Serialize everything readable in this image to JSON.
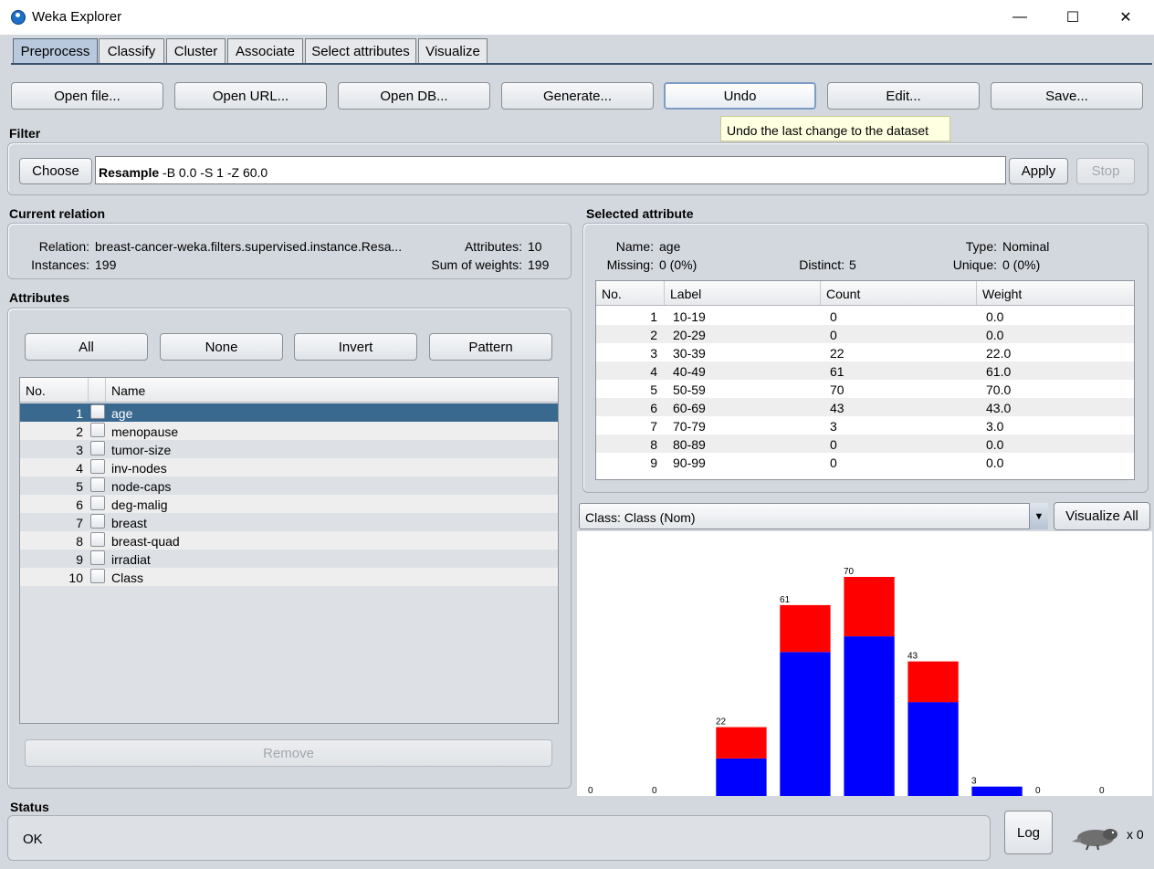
{
  "window": {
    "title": "Weka Explorer",
    "minimize": "—",
    "maximize": "☐",
    "close": "✕"
  },
  "tabs": [
    "Preprocess",
    "Classify",
    "Cluster",
    "Associate",
    "Select attributes",
    "Visualize"
  ],
  "toolbar": [
    "Open file...",
    "Open URL...",
    "Open DB...",
    "Generate...",
    "Undo",
    "Edit...",
    "Save..."
  ],
  "tooltip": "Undo the last change to the dataset",
  "filter": {
    "label": "Filter",
    "choose": "Choose",
    "name": "Resample",
    "options": " -B 0.0 -S 1 -Z 60.0",
    "apply": "Apply",
    "stop": "Stop"
  },
  "relation": {
    "label": "Current relation",
    "relation_label": "Relation:",
    "relation_value": "breast-cancer-weka.filters.supervised.instance.Resa...",
    "instances_label": "Instances:",
    "instances_value": "199",
    "attributes_label": "Attributes:",
    "attributes_value": "10",
    "sow_label": "Sum of weights:",
    "sow_value": "199"
  },
  "attributes": {
    "label": "Attributes",
    "buttons": [
      "All",
      "None",
      "Invert",
      "Pattern"
    ],
    "col_no": "No.",
    "col_name": "Name",
    "rows": [
      {
        "no": "1",
        "name": "age"
      },
      {
        "no": "2",
        "name": "menopause"
      },
      {
        "no": "3",
        "name": "tumor-size"
      },
      {
        "no": "4",
        "name": "inv-nodes"
      },
      {
        "no": "5",
        "name": "node-caps"
      },
      {
        "no": "6",
        "name": "deg-malig"
      },
      {
        "no": "7",
        "name": "breast"
      },
      {
        "no": "8",
        "name": "breast-quad"
      },
      {
        "no": "9",
        "name": "irradiat"
      },
      {
        "no": "10",
        "name": "Class"
      }
    ],
    "remove": "Remove"
  },
  "selected": {
    "label": "Selected attribute",
    "name_label": "Name:",
    "name_value": "age",
    "type_label": "Type:",
    "type_value": "Nominal",
    "missing_label": "Missing:",
    "missing_value": "0 (0%)",
    "distinct_label": "Distinct:",
    "distinct_value": "5",
    "unique_label": "Unique:",
    "unique_value": "0 (0%)",
    "cols": [
      "No.",
      "Label",
      "Count",
      "Weight"
    ],
    "rows": [
      {
        "no": "1",
        "label": "10-19",
        "count": "0",
        "weight": "0.0"
      },
      {
        "no": "2",
        "label": "20-29",
        "count": "0",
        "weight": "0.0"
      },
      {
        "no": "3",
        "label": "30-39",
        "count": "22",
        "weight": "22.0"
      },
      {
        "no": "4",
        "label": "40-49",
        "count": "61",
        "weight": "61.0"
      },
      {
        "no": "5",
        "label": "50-59",
        "count": "70",
        "weight": "70.0"
      },
      {
        "no": "6",
        "label": "60-69",
        "count": "43",
        "weight": "43.0"
      },
      {
        "no": "7",
        "label": "70-79",
        "count": "3",
        "weight": "3.0"
      },
      {
        "no": "8",
        "label": "80-89",
        "count": "0",
        "weight": "0.0"
      },
      {
        "no": "9",
        "label": "90-99",
        "count": "0",
        "weight": "0.0"
      }
    ]
  },
  "class_combo": "Class: Class (Nom)",
  "visualize_all": "Visualize All",
  "chart_data": {
    "type": "bar",
    "categories": [
      "10-19",
      "20-29",
      "30-39",
      "40-49",
      "50-59",
      "60-69",
      "70-79",
      "80-89",
      "90-99"
    ],
    "totals": [
      0,
      0,
      22,
      61,
      70,
      43,
      3,
      0,
      0
    ],
    "series": [
      {
        "values": [
          0,
          0,
          12,
          46,
          51,
          30,
          3,
          0,
          0
        ],
        "color": "#0000ff"
      },
      {
        "values": [
          0,
          0,
          10,
          15,
          19,
          13,
          0,
          0,
          0
        ],
        "color": "#ff0000"
      }
    ],
    "ylim": [
      0,
      70
    ]
  },
  "status": {
    "label": "Status",
    "text": "OK",
    "log": "Log",
    "count": "x 0"
  },
  "colors": {
    "selected_row": "#39698f",
    "accent": "#38516e"
  }
}
